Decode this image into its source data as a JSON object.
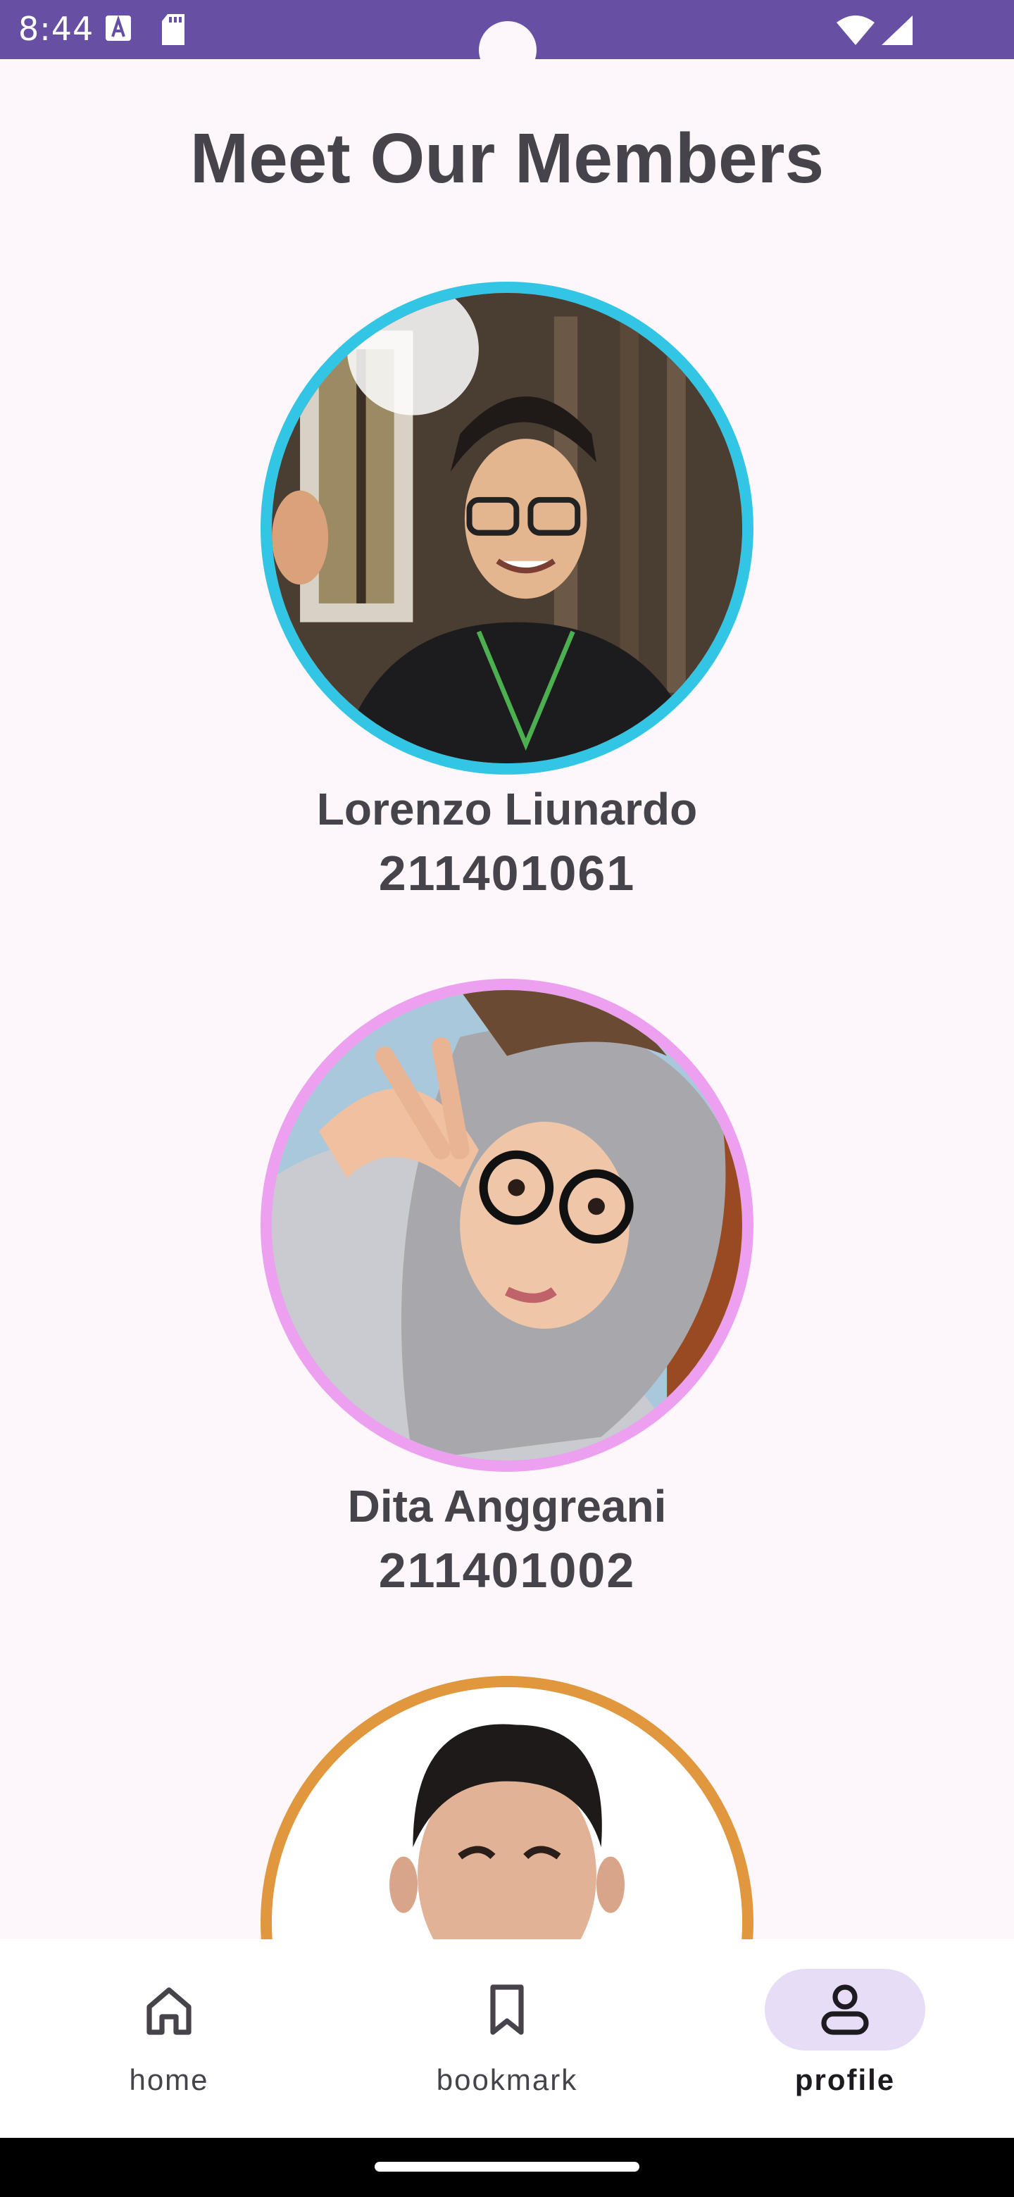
{
  "status_bar": {
    "time": "8:44",
    "icons": [
      "keyboard-a-icon",
      "sd-card-icon",
      "wifi-icon",
      "cell-signal-icon"
    ],
    "background_color": "#6750a4"
  },
  "page": {
    "title": "Meet Our Members"
  },
  "members": [
    {
      "name": "Lorenzo Liunardo",
      "id": "211401061",
      "ring_color": "#33c6e4"
    },
    {
      "name": "Dita Anggreani",
      "id": "211401002",
      "ring_color": "#eca0ef"
    },
    {
      "name": "",
      "id": "",
      "ring_color": "#e0973e"
    }
  ],
  "bottom_nav": {
    "items": [
      {
        "label": "home",
        "icon": "home-icon",
        "active": false
      },
      {
        "label": "bookmark",
        "icon": "bookmark-icon",
        "active": false
      },
      {
        "label": "profile",
        "icon": "profile-icon",
        "active": true
      }
    ],
    "active_indicator_color": "#e8ddf6"
  }
}
